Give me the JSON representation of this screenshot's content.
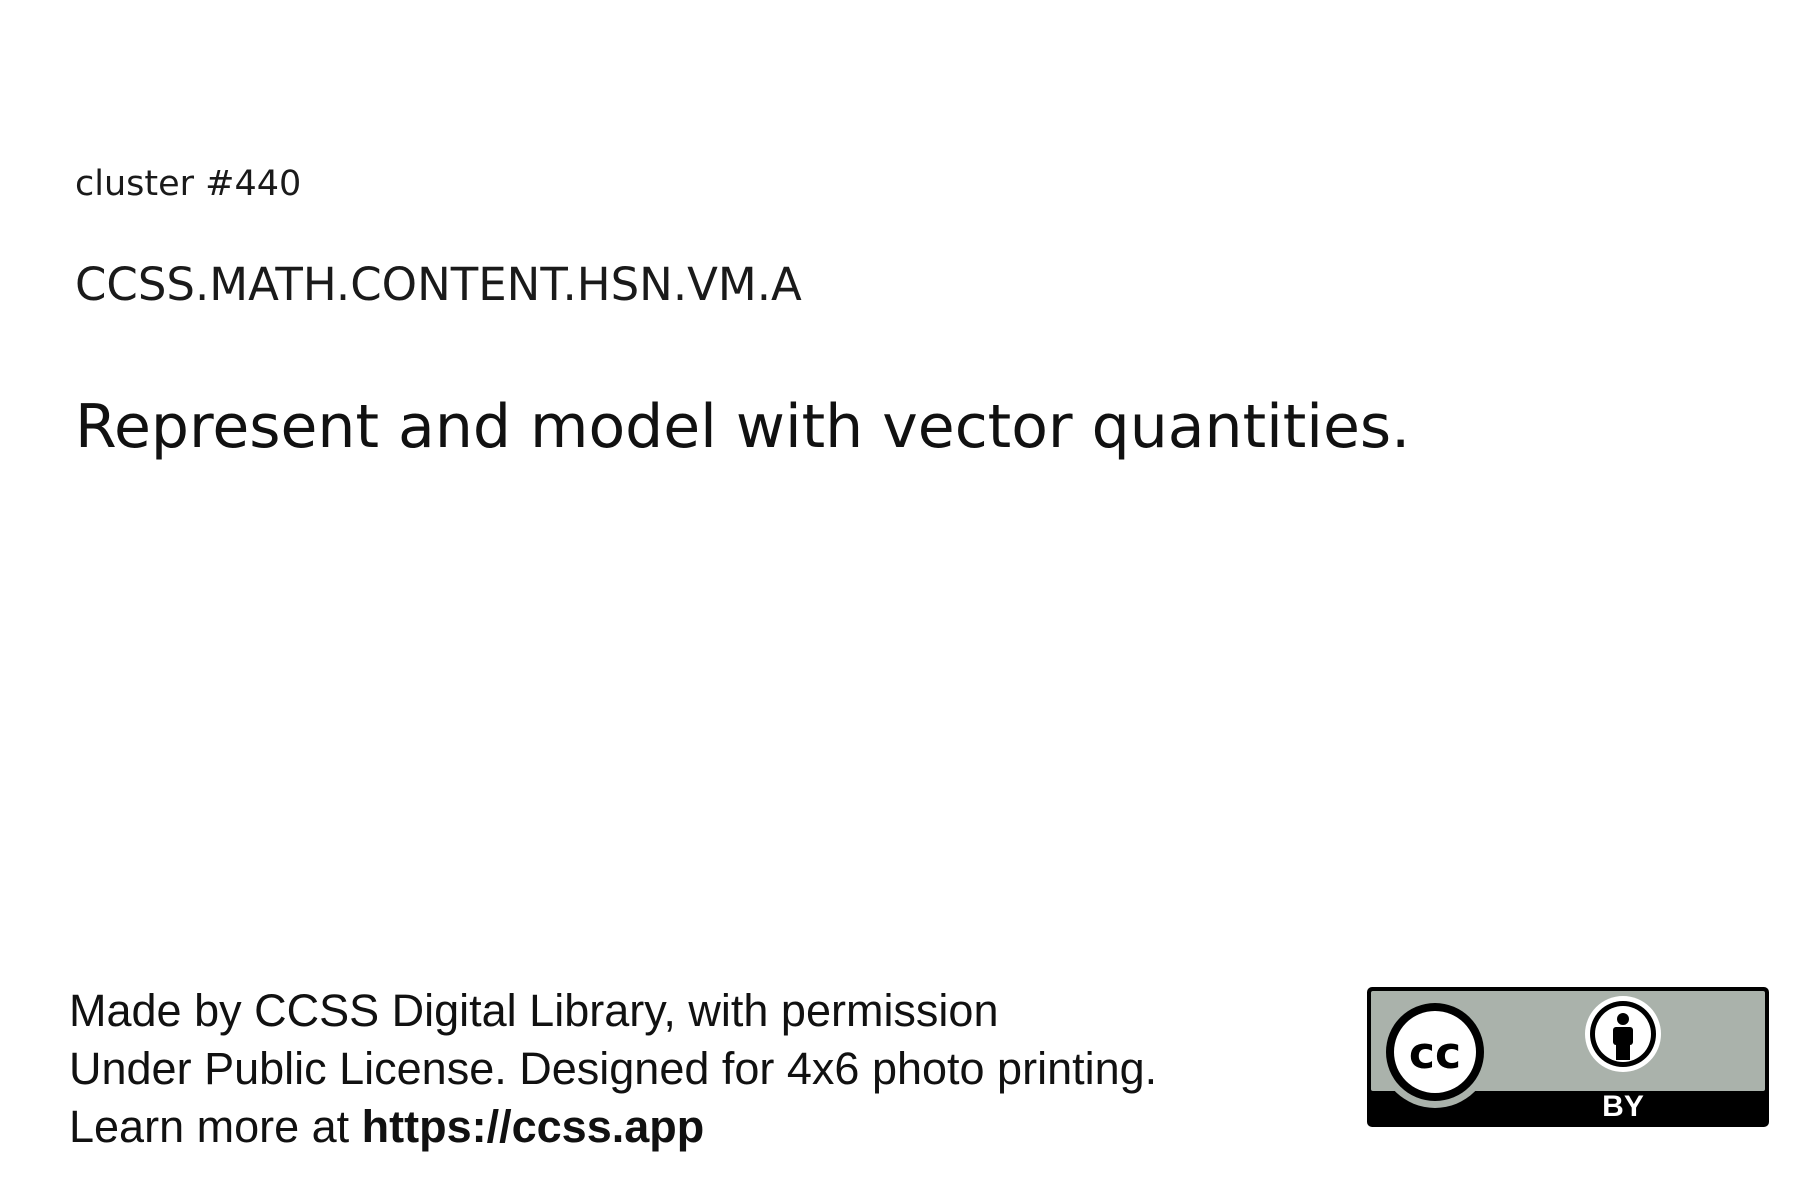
{
  "card": {
    "cluster_label": "cluster #440",
    "standard_code": "CCSS.MATH.CONTENT.HSN.VM.A",
    "title": "Represent and model with vector quantities."
  },
  "footer": {
    "line1": "Made by CCSS Digital Library, with permission",
    "line2": "Under Public License. Designed for 4x6 photo printing.",
    "line3_prefix": "Learn more at ",
    "link_text": "https://ccss.app"
  },
  "license": {
    "cc_text": "cc",
    "by_text": "BY",
    "icons": [
      "creative-commons-icon",
      "attribution-person-icon"
    ],
    "colors": {
      "badge_gray": "#aab2ab",
      "badge_black": "#000000",
      "circle_white": "#ffffff"
    }
  }
}
